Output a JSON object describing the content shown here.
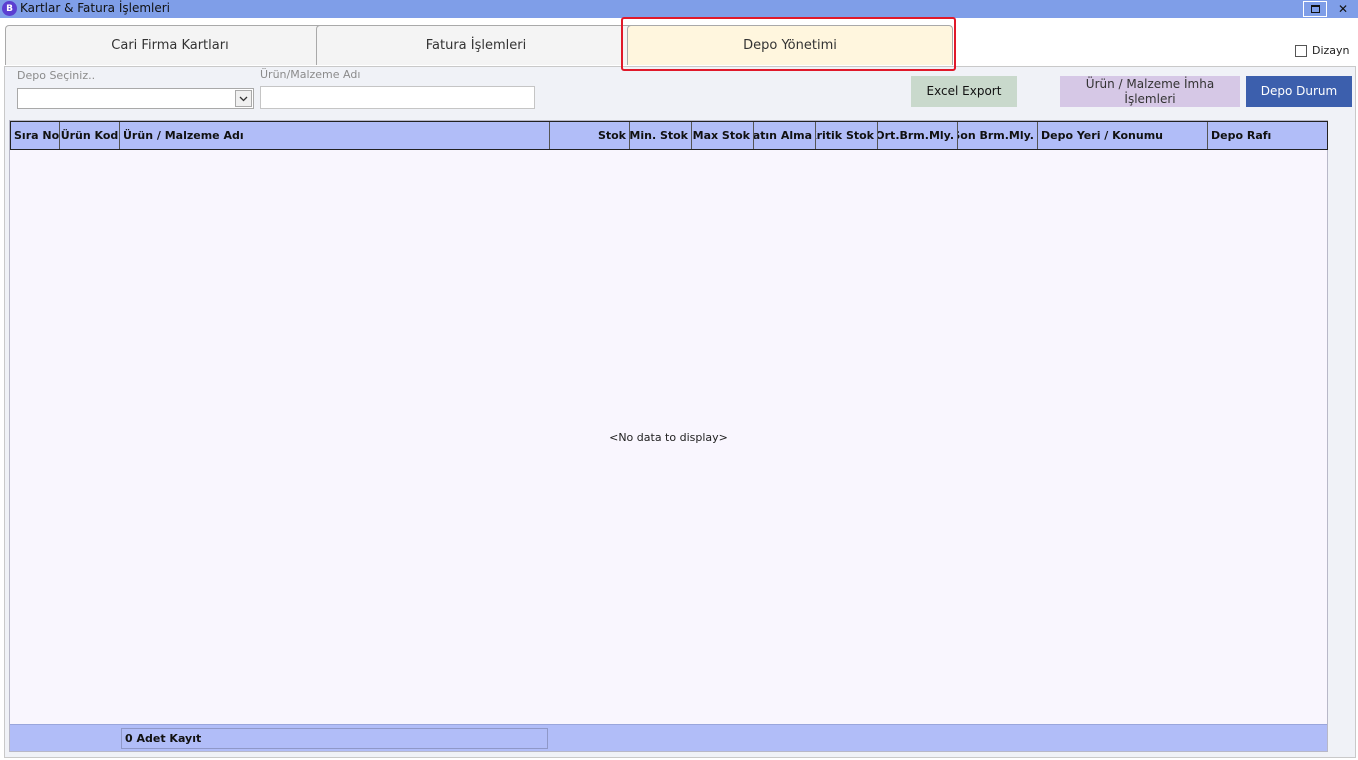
{
  "window": {
    "logo": "B",
    "title": "Kartlar & Fatura İşlemleri",
    "close": "✕"
  },
  "tabs": [
    {
      "label": "Cari Firma Kartları",
      "active": false
    },
    {
      "label": "Fatura İşlemleri",
      "active": false
    },
    {
      "label": "Depo Yönetimi",
      "active": true
    }
  ],
  "dizayn": {
    "label": "Dizayn",
    "checked": false
  },
  "filters": {
    "depo_label": "Depo Seçiniz..",
    "depo_value": "",
    "urun_label": "Ürün/Malzeme Adı",
    "urun_value": ""
  },
  "buttons": {
    "excel": "Excel Export",
    "imha": "Ürün / Malzeme İmha İşlemleri",
    "depo_durum": "Depo Durum"
  },
  "grid": {
    "columns": [
      "Sıra No",
      "Ürün Kod",
      "Ürün / Malzeme Adı",
      "Stok",
      "Min. Stok",
      "Max Stok",
      "Satın Alma",
      "Kritik Stok",
      "Ort.Brm.Mly.",
      "Son Brm.Mly.",
      "Depo Yeri / Konumu",
      "Depo Rafı"
    ],
    "rows": [],
    "empty_text": "<No data to display>",
    "footer_count": "0 Adet Kayıt"
  },
  "colors": {
    "titlebar": "#7f9ee8",
    "active_tab": "#fff6de",
    "grid_header": "#b1bdf8",
    "highlight": "#e0192a",
    "depo_button": "#3c5fad"
  }
}
